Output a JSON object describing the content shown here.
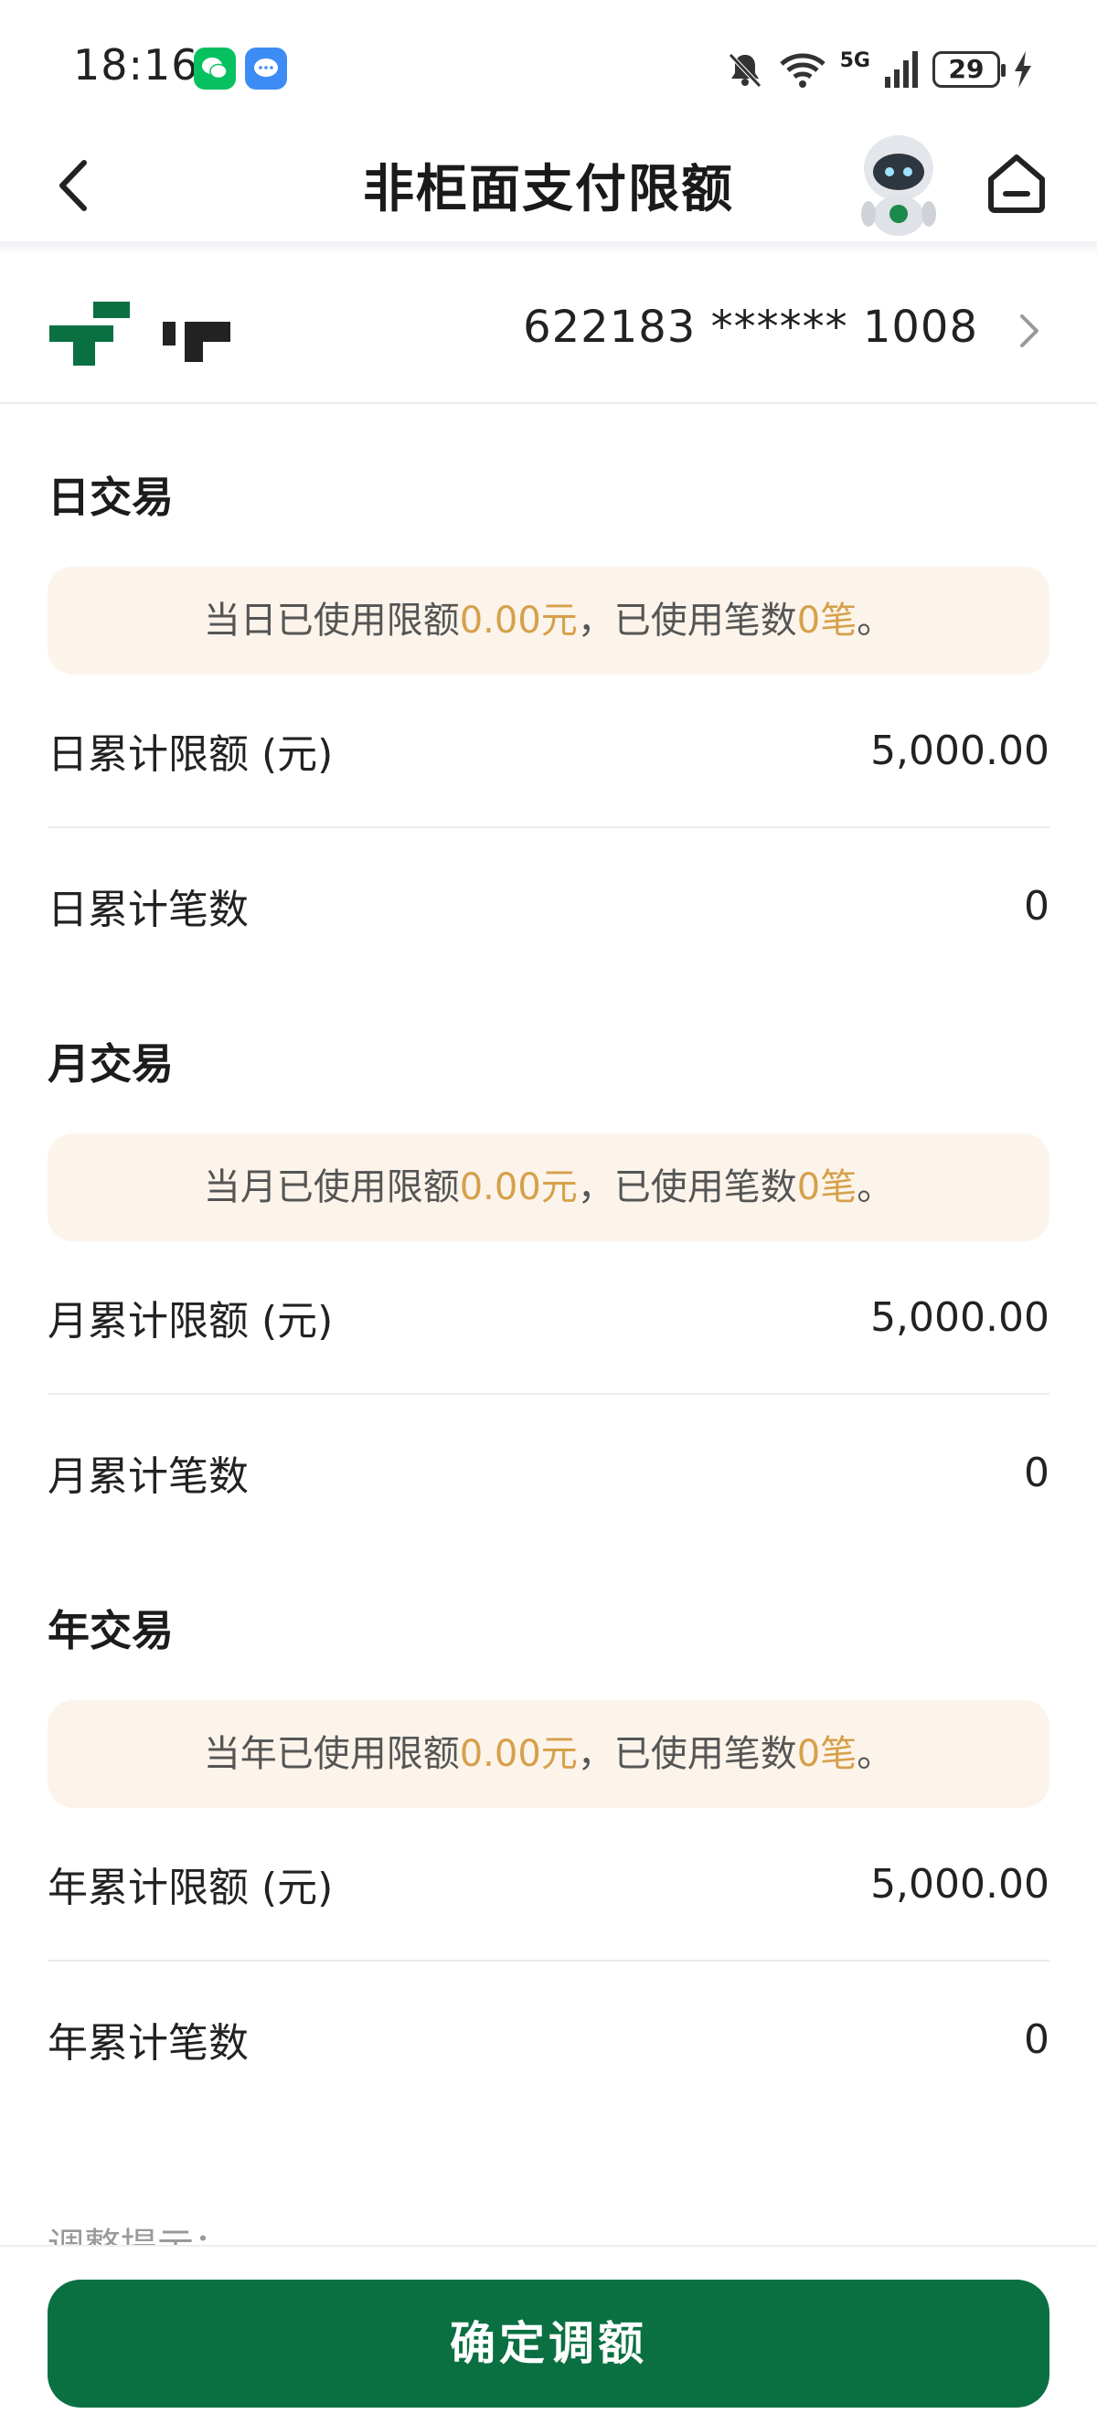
{
  "status_bar": {
    "time": "18:16",
    "network": "5G",
    "battery": "29"
  },
  "nav": {
    "title": "非柜面支付限额"
  },
  "card": {
    "number": "622183 ****** 1008"
  },
  "sections": [
    {
      "title": "日交易",
      "usage_prefix": "当日已使用限额",
      "usage_amount": "0.00元",
      "usage_middle": "，已使用笔数",
      "usage_count": "0笔",
      "usage_suffix": "。",
      "limit_label": "日累计限额 (元)",
      "limit_value": "5,000.00",
      "count_label": "日累计笔数",
      "count_value": "0"
    },
    {
      "title": "月交易",
      "usage_prefix": "当月已使用限额",
      "usage_amount": "0.00元",
      "usage_middle": "，已使用笔数",
      "usage_count": "0笔",
      "usage_suffix": "。",
      "limit_label": "月累计限额 (元)",
      "limit_value": "5,000.00",
      "count_label": "月累计笔数",
      "count_value": "0"
    },
    {
      "title": "年交易",
      "usage_prefix": "当年已使用限额",
      "usage_amount": "0.00元",
      "usage_middle": "，已使用笔数",
      "usage_count": "0笔",
      "usage_suffix": "。",
      "limit_label": "年累计限额 (元)",
      "limit_value": "5,000.00",
      "count_label": "年累计笔数",
      "count_value": "0"
    }
  ],
  "tip_heading": "调整提示：",
  "footer": {
    "confirm_label": "确定调额"
  },
  "colors": {
    "primary_green": "#0a7042",
    "highlight": "#d6a04a",
    "usage_bg": "#fcf4eb"
  },
  "icons": [
    "back-arrow-icon",
    "home-icon",
    "mascot-robot-icon",
    "chevron-right-icon",
    "wechat-icon",
    "message-icon",
    "mute-bell-icon",
    "wifi-icon",
    "signal-icon",
    "charging-icon"
  ]
}
